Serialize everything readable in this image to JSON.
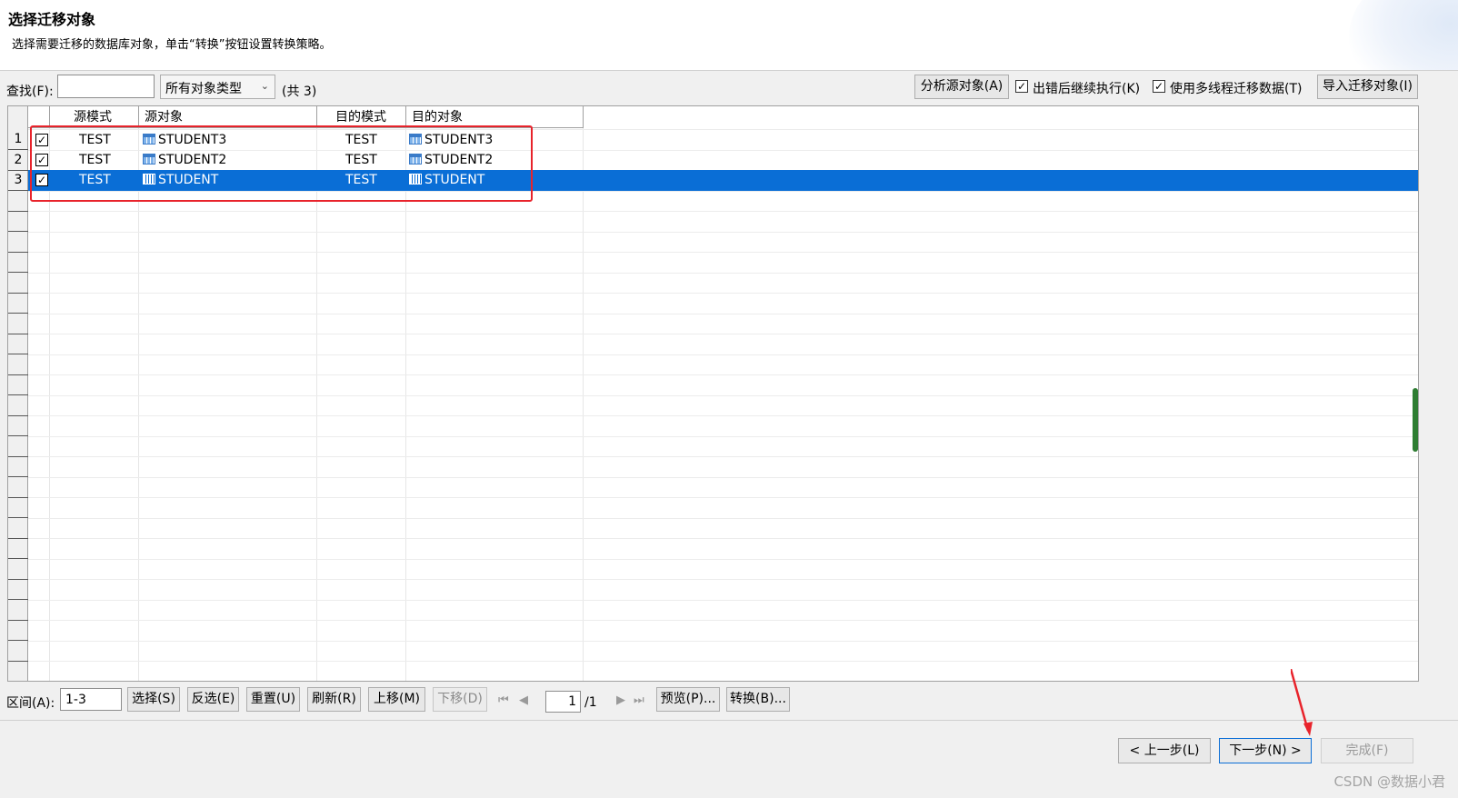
{
  "header": {
    "title": "选择迁移对象",
    "description": "选择需要迁移的数据库对象，单击“转换”按钮设置转换策略。"
  },
  "toolbar": {
    "find_label": "查找(F):",
    "find_value": "",
    "type_filter": "所有对象类型",
    "count": "(共 3)",
    "analyze_button": "分析源对象(A)",
    "continue_on_error_label": "出错后继续执行(K)",
    "continue_on_error_checked": true,
    "multithread_label": "使用多线程迁移数据(T)",
    "multithread_checked": true,
    "import_button": "导入迁移对象(I)"
  },
  "grid": {
    "columns": [
      "源模式",
      "源对象",
      "目的模式",
      "目的对象"
    ],
    "rows": [
      {
        "num": "1",
        "checked": true,
        "src_schema": "TEST",
        "src_object": "STUDENT3",
        "dst_schema": "TEST",
        "dst_object": "STUDENT3",
        "selected": false
      },
      {
        "num": "2",
        "checked": true,
        "src_schema": "TEST",
        "src_object": "STUDENT2",
        "dst_schema": "TEST",
        "dst_object": "STUDENT2",
        "selected": false
      },
      {
        "num": "3",
        "checked": true,
        "src_schema": "TEST",
        "src_object": "STUDENT",
        "dst_schema": "TEST",
        "dst_object": "STUDENT",
        "selected": true
      }
    ]
  },
  "bottom": {
    "range_label": "区间(A):",
    "range_value": "1-3",
    "select_button": "选择(S)",
    "invert_button": "反选(E)",
    "reset_button": "重置(U)",
    "refresh_button": "刷新(R)",
    "move_up_button": "上移(M)",
    "move_down_button": "下移(D)",
    "page_value": "1",
    "page_total": "/1",
    "preview_button": "预览(P)...",
    "convert_button": "转换(B)..."
  },
  "footer": {
    "back_button": "< 上一步(L)",
    "next_button": "下一步(N) >",
    "finish_button": "完成(F)"
  },
  "watermark": "CSDN @数据小君",
  "colors": {
    "selection": "#0a6ed6",
    "highlight_box": "#e8232b"
  }
}
